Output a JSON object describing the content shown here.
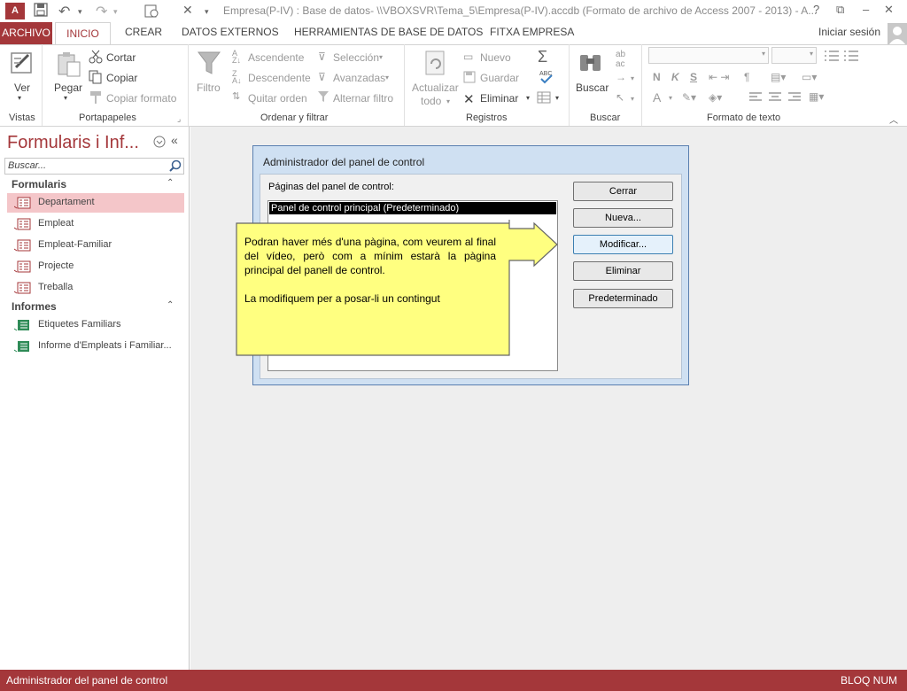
{
  "window": {
    "title": "Empresa(P-IV) : Base de datos- \\\\VBOXSVR\\Tema_5\\Empresa(P-IV).accdb (Formato de archivo de Access 2007 - 2013) - A...",
    "help": "?",
    "restore": "⧉",
    "minimize": "–",
    "maximize": "❐",
    "close": "✕"
  },
  "tabs": {
    "archivo": "ARCHIVO",
    "inicio": "INICIO",
    "crear": "CREAR",
    "datos_externos": "DATOS EXTERNOS",
    "herramientas": "HERRAMIENTAS DE BASE DE DATOS",
    "fitxa": "FITXA EMPRESA",
    "signin": "Iniciar sesión"
  },
  "ribbon": {
    "vistas": {
      "label": "Vistas",
      "ver": "Ver"
    },
    "portapapeles": {
      "label": "Portapapeles",
      "pegar": "Pegar",
      "cortar": "Cortar",
      "copiar": "Copiar",
      "copiar_formato": "Copiar formato"
    },
    "ordenar": {
      "label": "Ordenar y filtrar",
      "filtro": "Filtro",
      "ascendente": "Ascendente",
      "descendente": "Descendente",
      "quitar": "Quitar orden",
      "seleccion": "Selección",
      "avanzadas": "Avanzadas",
      "alternar": "Alternar filtro"
    },
    "registros": {
      "label": "Registros",
      "actualizar": "Actualizar",
      "todo": "todo",
      "nuevo": "Nuevo",
      "guardar": "Guardar",
      "eliminar": "Eliminar"
    },
    "buscar": {
      "label": "Buscar",
      "buscar": "Buscar"
    },
    "formato": {
      "label": "Formato de texto",
      "bold": "N",
      "italic": "K",
      "underline": "S",
      "fontcolor": "A"
    }
  },
  "nav": {
    "title": "Formularis i Inf...",
    "search_placeholder": "Buscar...",
    "sections": [
      {
        "name": "Formularis",
        "items": [
          "Departament",
          "Empleat",
          "Empleat-Familiar",
          "Projecte",
          "Treballa"
        ]
      },
      {
        "name": "Informes",
        "items": [
          "Etiquetes Familiars",
          "Informe d'Empleats i Familiar..."
        ]
      }
    ],
    "selected": "Departament"
  },
  "dialog": {
    "title": "Administrador del panel de control",
    "list_label": "Páginas del panel de control:",
    "list_items": [
      "Panel de control principal (Predeterminado)"
    ],
    "buttons": {
      "cerrar": "Cerrar",
      "nueva": "Nueva...",
      "modificar": "Modificar...",
      "eliminar": "Eliminar",
      "predeterminado": "Predeterminado"
    }
  },
  "callout": {
    "line1": "Podran haver més d'una pàgina, com veurem al final del vídeo, però com a mínim estarà la pàgina principal del panell de control.",
    "line2": "La modifiquem per a posar-li un contingut"
  },
  "status": {
    "left": "Administrador del panel de control",
    "right": "BLOQ NUM"
  },
  "colors": {
    "accent": "#a4373a",
    "selected_item": "#f4c6c9",
    "callout_fill": "#ffff80",
    "dialog_frame": "#cfe0f2"
  }
}
